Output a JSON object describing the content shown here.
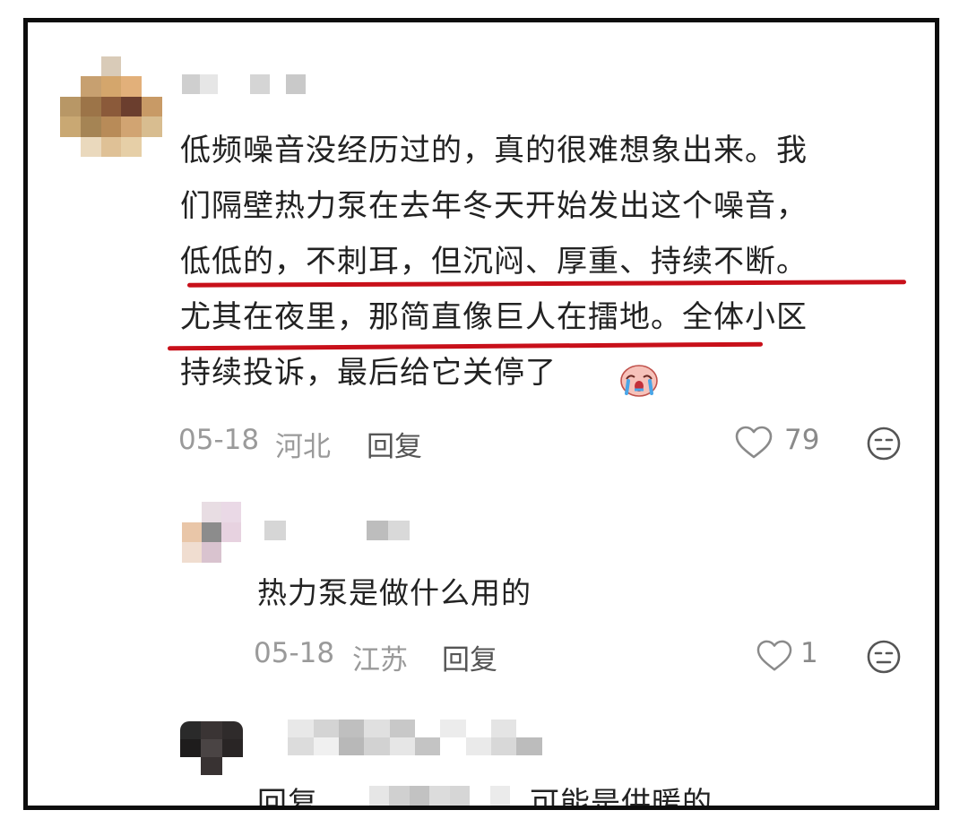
{
  "main_comment": {
    "text": "低频噪音没经历过的，真的很难想象出来。我\n们隔壁热力泵在去年冬天开始发出这个噪音，\n低低的，不刺耳，但沉闷、厚重、持续不断。\n尤其在夜里，那简直像巨人在擂地。全体小区\n持续投诉，最后给它关停了",
    "emoji": "crying-face-emoji",
    "date": "05-18",
    "location": "河北",
    "reply_label": "回复",
    "likes": "79"
  },
  "replies": [
    {
      "text": "热力泵是做什么用的",
      "date": "05-18",
      "location": "江苏",
      "reply_label": "回复",
      "likes": "1"
    },
    {
      "prefix": "回复",
      "text": "可能是供暖的"
    }
  ],
  "colors": {
    "underline": "#c8101a",
    "meta_text": "#9a9a9a",
    "frame_border": "#0d0d0d"
  }
}
